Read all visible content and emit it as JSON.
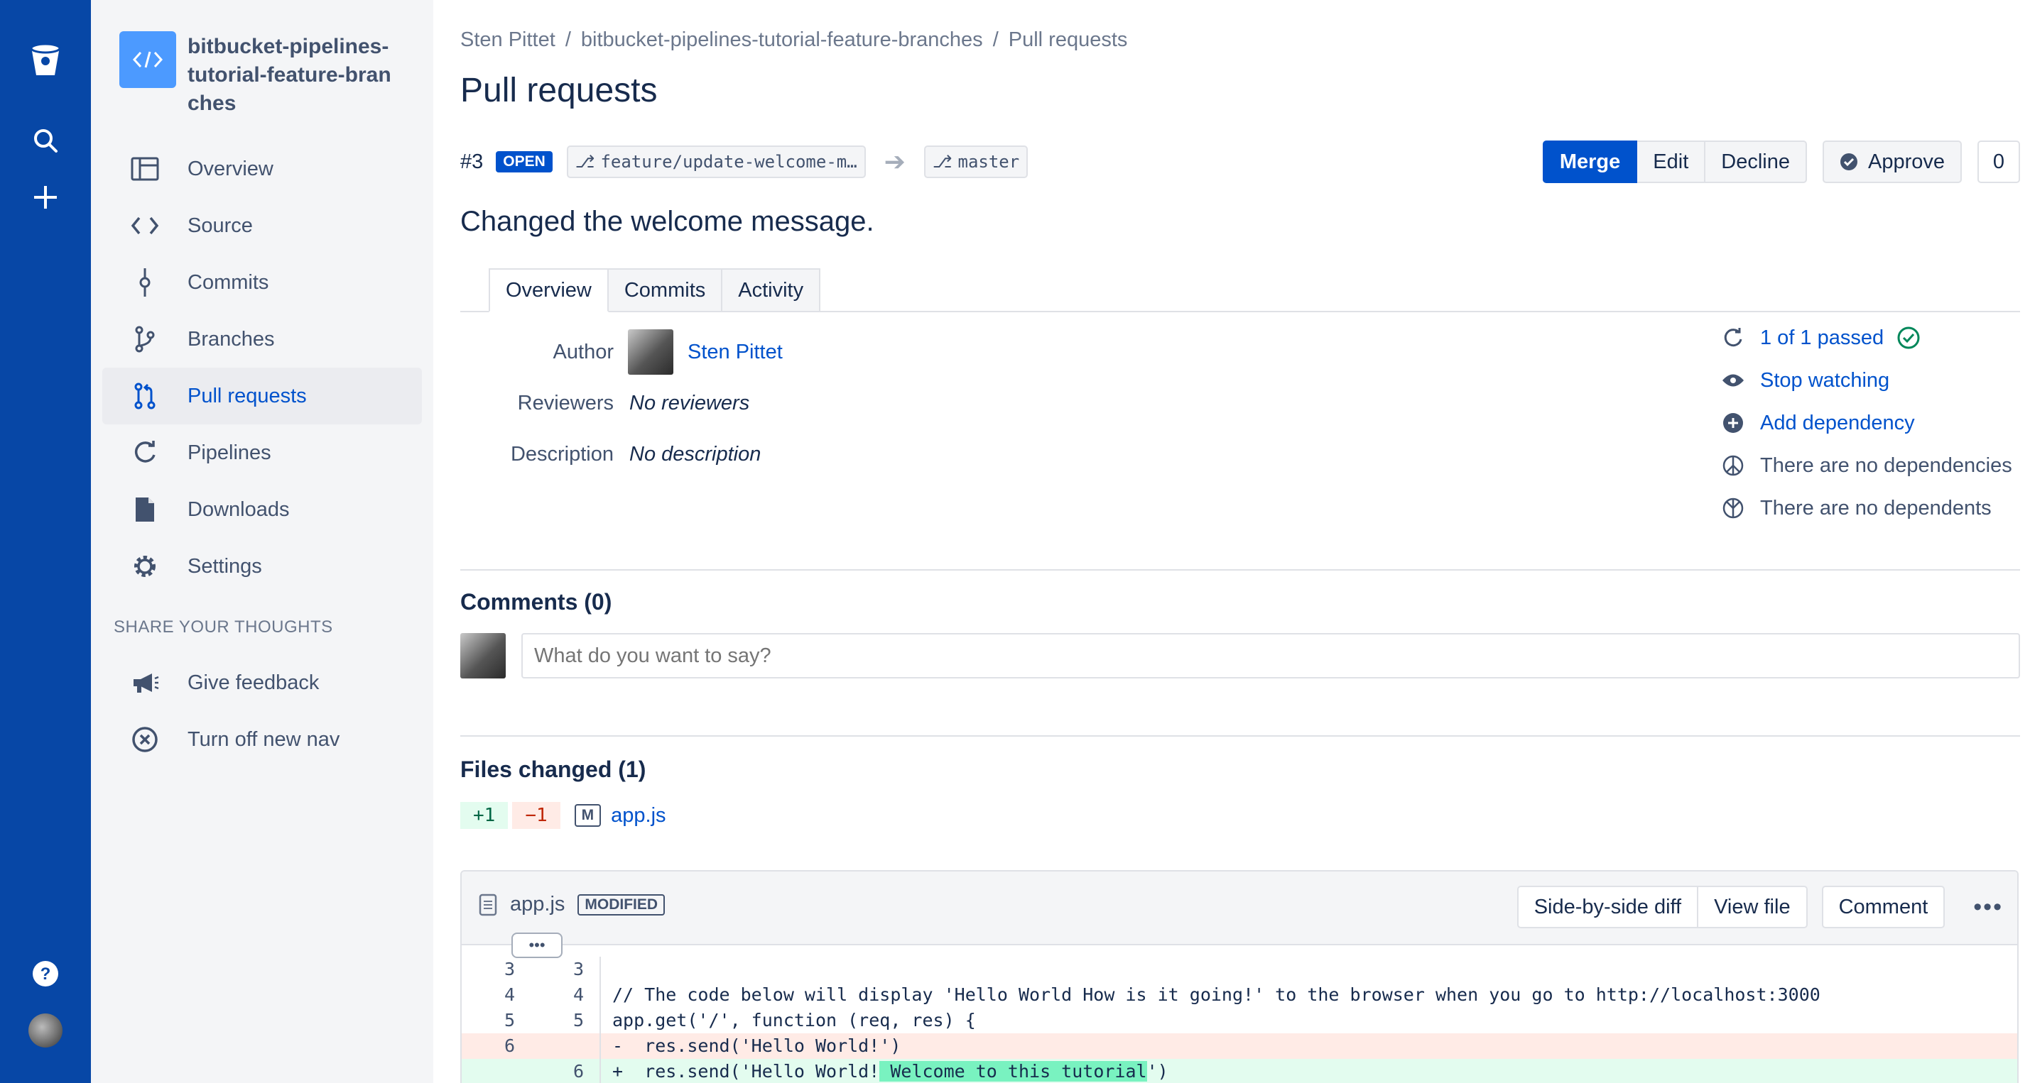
{
  "sidebar": {
    "repo_name": "bitbucket-pipelines-tutorial-feature-branches",
    "items": [
      {
        "label": "Overview",
        "icon": "overview-icon"
      },
      {
        "label": "Source",
        "icon": "source-code-icon"
      },
      {
        "label": "Commits",
        "icon": "commit-icon"
      },
      {
        "label": "Branches",
        "icon": "branches-icon"
      },
      {
        "label": "Pull requests",
        "icon": "pull-request-icon",
        "active": true
      },
      {
        "label": "Pipelines",
        "icon": "pipelines-icon"
      },
      {
        "label": "Downloads",
        "icon": "downloads-icon"
      },
      {
        "label": "Settings",
        "icon": "settings-gear-icon"
      }
    ],
    "section_title": "SHARE YOUR THOUGHTS",
    "extra_items": [
      {
        "label": "Give feedback",
        "icon": "megaphone-icon"
      },
      {
        "label": "Turn off new nav",
        "icon": "close-circle-icon"
      }
    ]
  },
  "breadcrumb": {
    "user": "Sten Pittet",
    "repo": "bitbucket-pipelines-tutorial-feature-branches",
    "page": "Pull requests",
    "separator": "/"
  },
  "page_title": "Pull requests",
  "pr": {
    "id": "#3",
    "status": "OPEN",
    "source_branch": "feature/update-welcome-m…",
    "target_branch": "master",
    "title": "Changed the welcome message."
  },
  "actions": {
    "merge": "Merge",
    "edit": "Edit",
    "decline": "Decline",
    "approve": "Approve",
    "approve_count": "0"
  },
  "tabs": [
    "Overview",
    "Commits",
    "Activity"
  ],
  "meta": {
    "author_label": "Author",
    "author_name": "Sten Pittet",
    "reviewers_label": "Reviewers",
    "reviewers_value": "No reviewers",
    "description_label": "Description",
    "description_value": "No description"
  },
  "side_meta": {
    "builds": "1 of 1 passed",
    "watch": "Stop watching",
    "add_dependency": "Add dependency",
    "no_dependencies": "There are no dependencies",
    "no_dependents": "There are no dependents"
  },
  "comments": {
    "title": "Comments (0)",
    "placeholder": "What do you want to say?"
  },
  "files": {
    "title": "Files changed (1)",
    "added": "+1",
    "removed": "−1",
    "status_badge": "M",
    "file_name": "app.js"
  },
  "diff": {
    "file_name": "app.js",
    "status": "MODIFIED",
    "side_by_side": "Side-by-side diff",
    "view_file": "View file",
    "comment": "Comment",
    "more": "•••",
    "expander": "•••",
    "lines": [
      {
        "old": "3",
        "new": "3",
        "type": "ctx",
        "code": ""
      },
      {
        "old": "4",
        "new": "4",
        "type": "ctx",
        "code": "// The code below will display 'Hello World How is it going!' to the browser when you go to http://localhost:3000"
      },
      {
        "old": "5",
        "new": "5",
        "type": "ctx",
        "code": "app.get('/', function (req, res) {"
      },
      {
        "old": "6",
        "new": "",
        "type": "del",
        "code": "-  res.send('Hello World!')"
      },
      {
        "old": "",
        "new": "6",
        "type": "add",
        "code_pre": "+  res.send('Hello World!",
        "code_hl": " Welcome to this tutorial",
        "code_post": "')"
      }
    ]
  },
  "colors": {
    "global_nav": "#0747a6",
    "sidebar_bg": "#f4f5f7",
    "primary": "#0052cc",
    "success": "#00875a"
  }
}
